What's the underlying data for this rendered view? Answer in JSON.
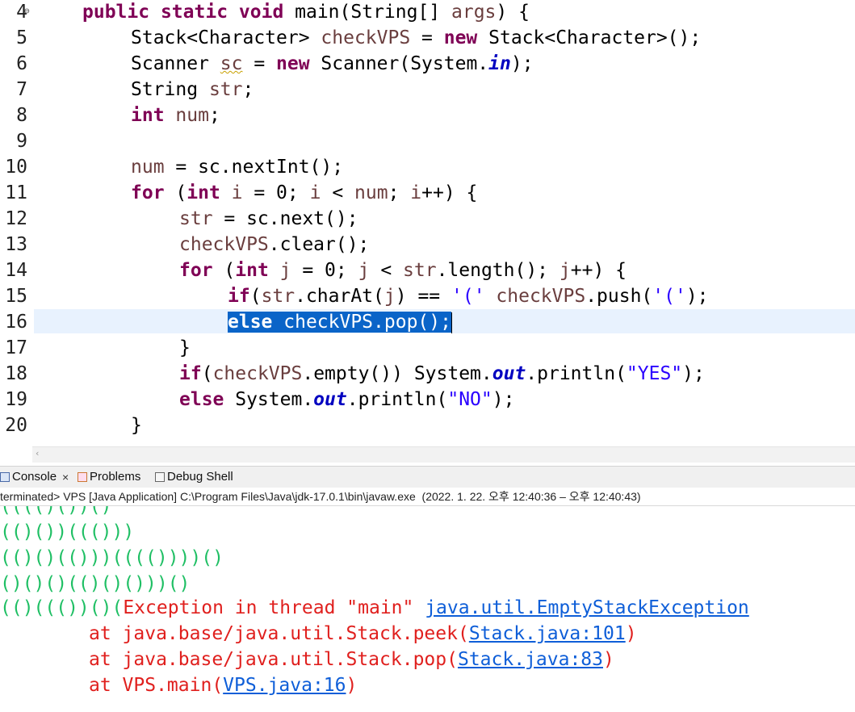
{
  "editor": {
    "lines": [
      {
        "n": "4"
      },
      {
        "n": "5"
      },
      {
        "n": "6"
      },
      {
        "n": "7"
      },
      {
        "n": "8"
      },
      {
        "n": "9"
      },
      {
        "n": "10"
      },
      {
        "n": "11"
      },
      {
        "n": "12"
      },
      {
        "n": "13"
      },
      {
        "n": "14"
      },
      {
        "n": "15"
      },
      {
        "n": "16"
      },
      {
        "n": "17"
      },
      {
        "n": "18"
      },
      {
        "n": "19"
      },
      {
        "n": "20"
      }
    ],
    "fold_marker": "⊖",
    "t": {
      "public": "public",
      "static": "static",
      "void": "void",
      "main_sig": " main(String[] ",
      "args": "args",
      "brace_open": ") {",
      "stack_decl": "Stack<Character> ",
      "checkVPS": "checkVPS",
      "assign": " = ",
      "new": "new",
      "stack_ctor": " Stack<Character>();",
      "scanner_type": "Scanner ",
      "sc": "sc",
      "scanner_ctor": " Scanner(System.",
      "in": "in",
      "close_paren_semi": ");",
      "string_type": "String ",
      "str": "str",
      "semi": ";",
      "int": "int",
      "num": "num",
      "nextint": " = sc.nextInt();",
      "for": "for",
      "paren_open": " (",
      "i": "i",
      "eq0": " = 0; ",
      "lt": " < ",
      "num_semi": "; ",
      "ipp": "++) {",
      "str_assign": " = sc.next();",
      "clear": ".clear();",
      "j": "j",
      "len": ".length(); ",
      "jpp": "++) {",
      "if": "if",
      "charat": ".charAt(",
      "cmp": ") == ",
      "paren_lit": "'('",
      "push_pre": " ",
      "push": ".push(",
      "close_stmt": ");",
      "else": "else",
      "pop": ".pop();",
      "rbrace": "}",
      "empty": ".empty()) System.",
      "out": "out",
      "println": ".println(",
      "yes": "\"YES\"",
      "no": "\"NO\"",
      "sysout": " System."
    }
  },
  "hscroll": {
    "left_arrow": "‹"
  },
  "console_tabs": [
    {
      "label": "Console",
      "close": "×"
    },
    {
      "label": "Problems"
    },
    {
      "label": "Debug Shell"
    }
  ],
  "status": {
    "text": "terminated> VPS [Java Application] C:\\Program Files\\Java\\jdk-17.0.1\\bin\\javaw.exe  (2022. 1. 22. 오후 12:40:36 – 오후 12:40:43)"
  },
  "console": {
    "input_lines": [
      "(((()())()",
      "(()())((()))",
      "(()()(()))(((())))()",
      "()()()(()()()))()",
      "(()((())()("
    ],
    "exception_text": "Exception in thread \"main\" ",
    "exception_link": "java.util.EmptyStackException",
    "trace": [
      {
        "pre": "at java.base/java.util.Stack.peek(",
        "link": "Stack.java:101",
        "post": ")"
      },
      {
        "pre": "at java.base/java.util.Stack.pop(",
        "link": "Stack.java:83",
        "post": ")"
      },
      {
        "pre": "at VPS.main(",
        "link": "VPS.java:16",
        "post": ")"
      }
    ]
  },
  "colors": {
    "keyword": "#7f0055",
    "variable": "#6a3e3e",
    "string": "#2a00ff",
    "selection": "#0a64c8",
    "console_input": "#1fbf64",
    "console_error": "#e0201e",
    "console_link": "#0e5ed8"
  }
}
